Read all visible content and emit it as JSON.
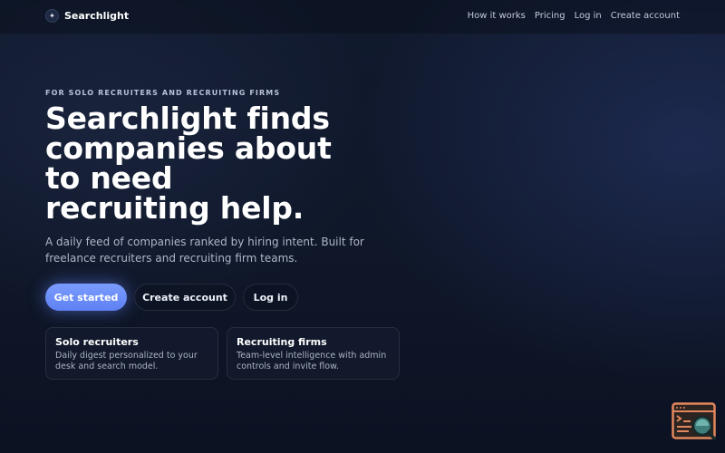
{
  "brand": {
    "icon": "sparkle-icon",
    "name": "Searchlight"
  },
  "nav": {
    "how_it_works": "How it works",
    "pricing": "Pricing",
    "log_in": "Log in",
    "create_account": "Create account"
  },
  "hero": {
    "eyebrow": "FOR SOLO RECRUITERS AND RECRUITING FIRMS",
    "headline": "Searchlight finds companies about to need recruiting help.",
    "subtext": "A daily feed of companies ranked by hiring intent. Built for freelance recruiters and recruiting firm teams.",
    "buttons": {
      "get_started": "Get started",
      "create_account": "Create account",
      "log_in": "Log in"
    }
  },
  "cards": [
    {
      "title": "Solo recruiters",
      "description": "Daily digest personalized to your desk and search model."
    },
    {
      "title": "Recruiting firms",
      "description": "Team-level intelligence with admin controls and invite flow."
    }
  ],
  "widget": {
    "icon": "browser-search-icon"
  },
  "colors": {
    "background": "#0f1729",
    "primary": "#6b8cff",
    "text": "#ffffff",
    "muted": "#aeb6c8"
  }
}
